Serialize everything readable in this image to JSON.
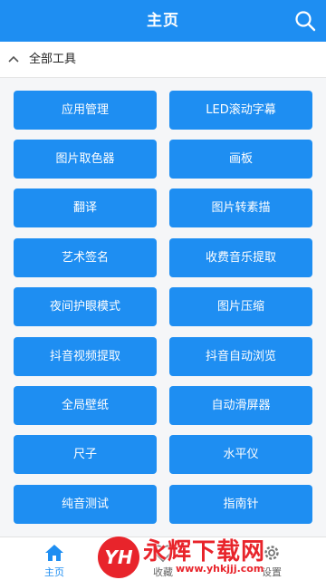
{
  "header": {
    "title": "主页",
    "search_icon": "search-icon"
  },
  "section": {
    "title": "全部工具",
    "chevron_icon": "chevron-up-icon"
  },
  "tools": [
    "应用管理",
    "LED滚动字幕",
    "图片取色器",
    "画板",
    "翻译",
    "图片转素描",
    "艺术签名",
    "收费音乐提取",
    "夜间护眼模式",
    "图片压缩",
    "抖音视频提取",
    "抖音自动浏览",
    "全局壁纸",
    "自动滑屏器",
    "尺子",
    "水平仪",
    "纯音测试",
    "指南针"
  ],
  "tabbar": {
    "tabs": [
      {
        "label": "主页",
        "icon": "home-icon",
        "active": true
      },
      {
        "label": "收藏",
        "icon": "heart-icon",
        "active": false
      },
      {
        "label": "设置",
        "icon": "gear-icon",
        "active": false
      }
    ]
  },
  "watermark": {
    "badge": "YH",
    "text": "永辉下载网",
    "url": "www.yhkjjj.com"
  },
  "colors": {
    "primary": "#1e8ef2",
    "watermark": "#e8242b"
  }
}
